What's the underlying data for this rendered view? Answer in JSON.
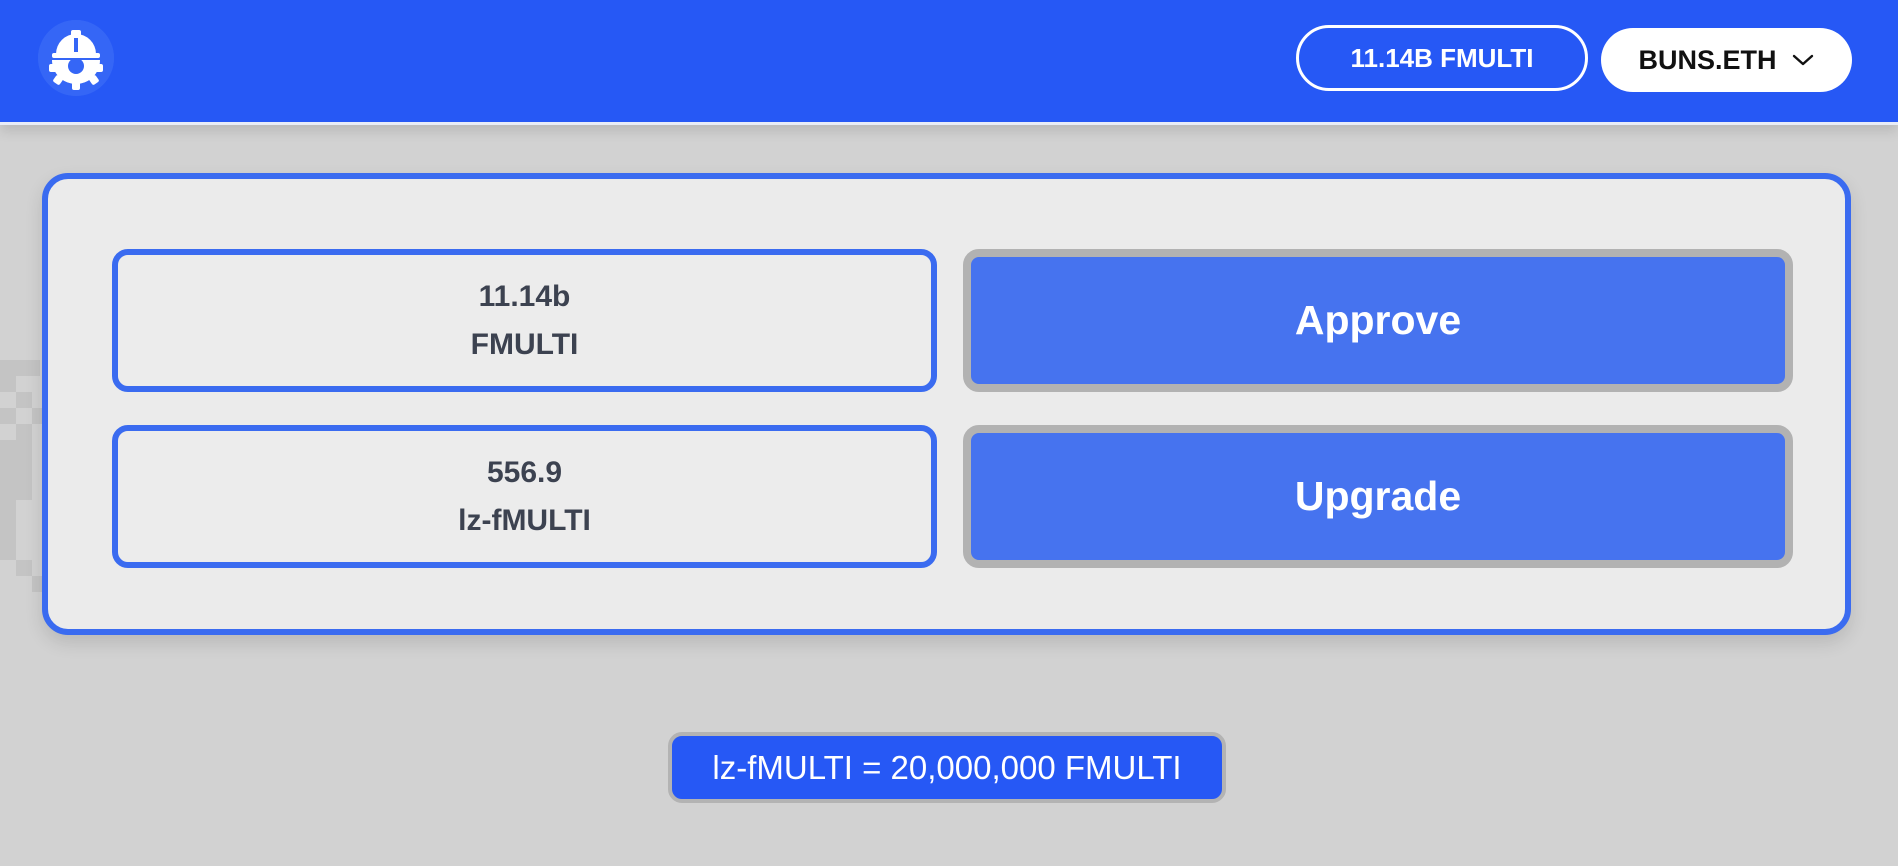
{
  "header": {
    "logo_icon": "hardhat-gear-icon",
    "balance_label": "11.14B FMULTI",
    "account_label": "BUNS.ETH",
    "account_dropdown_icon": "chevron-down-icon",
    "background_color": "#2658f5"
  },
  "upgrade_panel": {
    "balances": [
      {
        "amount": "11.14b",
        "token": "FMULTI"
      },
      {
        "amount": "556.9",
        "token": "lz-fMULTI"
      }
    ],
    "approve_label": "Approve",
    "upgrade_label": "Upgrade",
    "accent_color": "#3a6bf0",
    "button_color": "#4673ef"
  },
  "rate": {
    "text": "lz-fMULTI = 20,000,000 FMULTI"
  }
}
